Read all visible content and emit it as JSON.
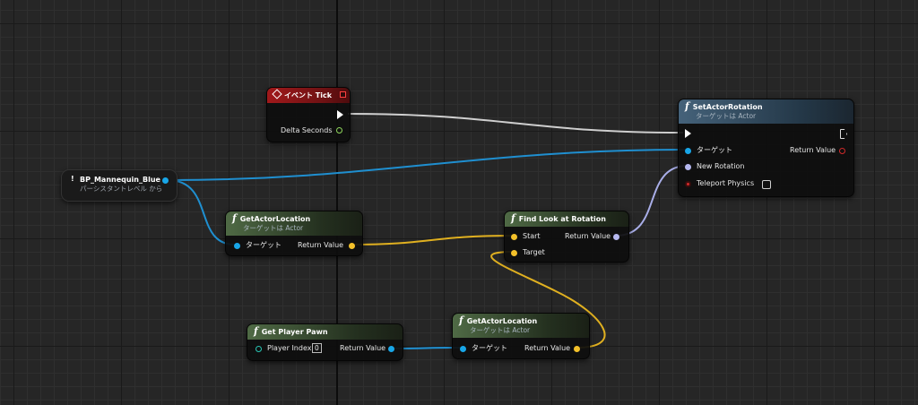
{
  "canvas": {
    "background": "#262626"
  },
  "nodes": {
    "event_tick": {
      "title": "イベント Tick",
      "delta_seconds_label": "Delta Seconds"
    },
    "set_actor_rotation": {
      "title": "SetActorRotation",
      "subtitle": "ターゲットは Actor",
      "target_label": "ターゲット",
      "return_value_label": "Return Value",
      "new_rotation_label": "New Rotation",
      "teleport_physics_label": "Teleport Physics"
    },
    "bp_mannequin": {
      "title": "BP_Mannequin_Blue",
      "subtitle": "パーシスタントレベル から"
    },
    "get_actor_location_1": {
      "title": "GetActorLocation",
      "subtitle": "ターゲットは Actor",
      "target_label": "ターゲット",
      "return_value_label": "Return Value"
    },
    "find_look_at_rotation": {
      "title": "Find Look at Rotation",
      "start_label": "Start",
      "target_label": "Target",
      "return_value_label": "Return Value"
    },
    "get_player_pawn": {
      "title": "Get Player Pawn",
      "player_index_label": "Player Index",
      "player_index_value": "0",
      "return_value_label": "Return Value"
    },
    "get_actor_location_2": {
      "title": "GetActorLocation",
      "subtitle": "ターゲットは Actor",
      "target_label": "ターゲット",
      "return_value_label": "Return Value"
    }
  },
  "colors": {
    "exec_wire": "#cfcfcf",
    "object_wire": "#1f8fd0",
    "vector_wire": "#e0b020",
    "rotator_wire": "#a9aee8",
    "event_header": "#a1191b",
    "pure_header": "#4f6a45",
    "impure_header": "#45627a"
  },
  "icons": {
    "function": "f",
    "event": "diamond-icon",
    "exec": "exec-pin-icon",
    "variable": "exclamation-icon"
  }
}
